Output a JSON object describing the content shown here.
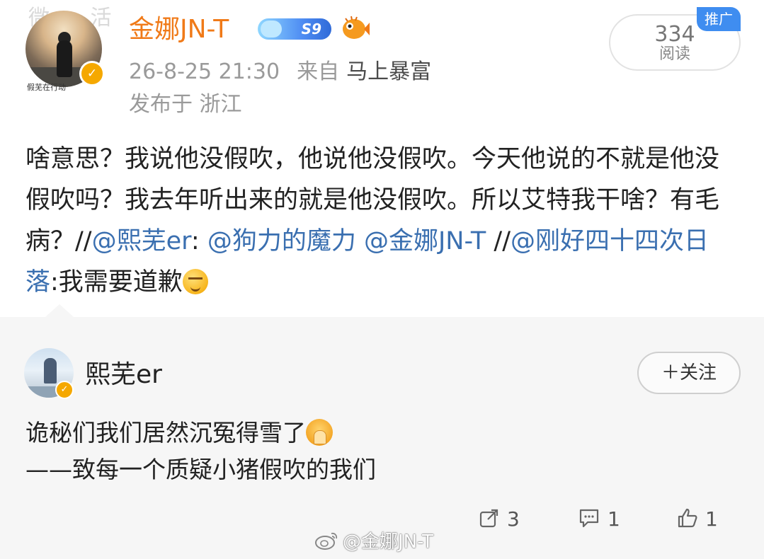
{
  "watermark_top": "微  活",
  "post": {
    "avatar_caption": "假芜在行动",
    "username": "金娜JN-T",
    "vip_level": "S9",
    "time": "26-8-25 21:30",
    "from_label": "来自",
    "source": "马上暴富",
    "location": "发布于 浙江",
    "read_count": "334",
    "read_label": "阅读",
    "promo_tag": "推广",
    "text": {
      "p1": "啥意思？我说他没假吹，他说他没假吹。今天他说的不就是他没假吹吗？我去年听出来的就是他没假吹。所以艾特我干啥？有毛病？//",
      "m1": "@熙芜er",
      "p2": ": ",
      "m2": "@狗力的魔力",
      "p3": " ",
      "m3": "@金娜JN-T",
      "p4": " //",
      "m4": "@刚好四十四次日落",
      "p5": ":我需要道歉"
    }
  },
  "repost": {
    "username": "熙芜er",
    "follow_label": "＋关注",
    "line1": "诡秘们我们居然沉冤得雪了",
    "line2": "——致每一个质疑小猪假吹的我们"
  },
  "stats": {
    "shares": "3",
    "comments": "1",
    "likes": "1"
  },
  "watermark_bottom": "@金娜JN-T",
  "colors": {
    "username": "#f07a18",
    "link": "#3a6fb0",
    "promo": "#3f8df0",
    "verified": "#f5a800"
  }
}
